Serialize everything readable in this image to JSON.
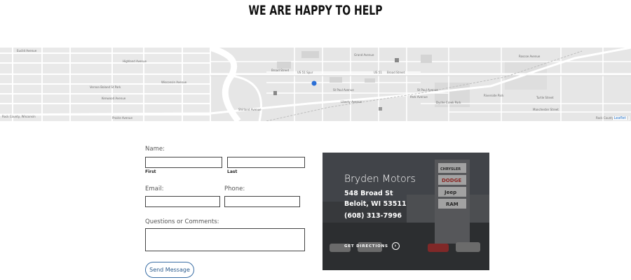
{
  "heading": "WE ARE HAPPY TO HELP",
  "map": {
    "street_labels": {
      "euclid": "Euclid Avenue",
      "highland": "Highland Avenue",
      "wisconsin": "Wisconsin Avenue",
      "kenwood": "Kenwood Avenue",
      "liberty": "Liberty Avenue",
      "broad": "Broad Street",
      "us51": "US 51 Spur",
      "us51b": "US 51",
      "broad2": "Broad Street",
      "stpaul": "St Paul Avenue",
      "stpaul2": "St Paul Avenue",
      "shirland": "Shirland Avenue",
      "grand": "Grand Avenue",
      "park": "Park Avenue",
      "turtle": "Turtle Street",
      "manchester": "Manchester Street",
      "prairie": "Prairie Avenue",
      "riverside": "Riverside Park",
      "roscoe": "Roscoe Avenue",
      "school": "Vernon Boland St Park",
      "park_name": "Dyche Creek Park",
      "county": "Rock County, Wisconsin",
      "county2": "Rock County"
    },
    "attribution": "Leaflet",
    "attribution_rest": "|"
  },
  "form": {
    "name_label": "Name:",
    "first_label": "First",
    "last_label": "Last",
    "email_label": "Email:",
    "phone_label": "Phone:",
    "comments_label": "Questions or Comments:",
    "first_value": "",
    "last_value": "",
    "email_value": "",
    "phone_value": "",
    "comments_value": "",
    "send_label": "Send Message"
  },
  "dealer": {
    "name": "Bryden Motors",
    "street": "548 Broad St",
    "city": "Beloit, WI 53511",
    "phone": "(608) 313-7996",
    "directions_label": "GET DIRECTIONS",
    "directions_icon": "chevron-right-circle-icon",
    "signs": [
      "CHRYSLER",
      "DODGE",
      "Jeep",
      "RAM"
    ]
  },
  "colors": {
    "map_bg": "#e6e6e6",
    "map_road": "#ffffff",
    "map_marker": "#2a6fd6",
    "button_border": "#3a6ea5",
    "card_bg": "#3b3b3b"
  }
}
